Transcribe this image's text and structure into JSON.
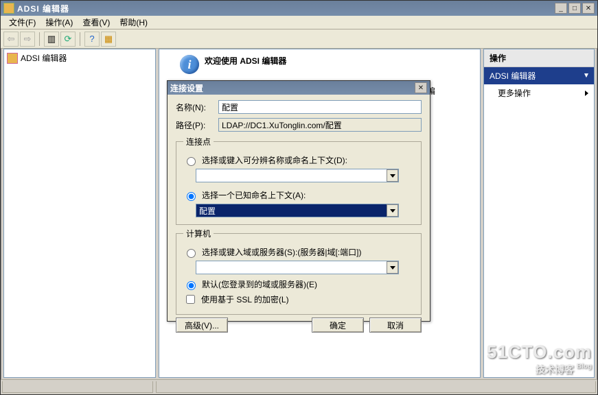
{
  "window": {
    "title": "ADSI 编辑器",
    "menus": {
      "file": "文件(F)",
      "action": "操作(A)",
      "view": "查看(V)",
      "help": "帮助(H)"
    }
  },
  "tree": {
    "root": "ADSI 编辑器"
  },
  "center": {
    "welcome_title": "欢迎使用 ADSI 编辑器",
    "side_text": "编",
    "side_comma": "，"
  },
  "actions": {
    "header": "操作",
    "selected": "ADSI 编辑器",
    "more": "更多操作"
  },
  "dialog": {
    "title": "连接设置",
    "name_label": "名称(N):",
    "name_value": "配置",
    "path_label": "路径(P):",
    "path_value": "LDAP://DC1.XuTonglin.com/配置",
    "conn_group": "连接点",
    "opt_dn": "选择或键入可分辨名称或命名上下文(D):",
    "opt_known": "选择一个已知命名上下文(A):",
    "known_value": "配置",
    "comp_group": "计算机",
    "opt_server": "选择或键入域或服务器(S):(服务器|域[:端口])",
    "opt_default": "默认(您登录到的域或服务器)(E)",
    "chk_ssl": "使用基于 SSL 的加密(L)",
    "btn_adv": "高级(V)...",
    "btn_ok": "确定",
    "btn_cancel": "取消"
  },
  "watermark": {
    "l1": "51CTO.com",
    "l2": "技术博客",
    "blog": "Blog"
  }
}
